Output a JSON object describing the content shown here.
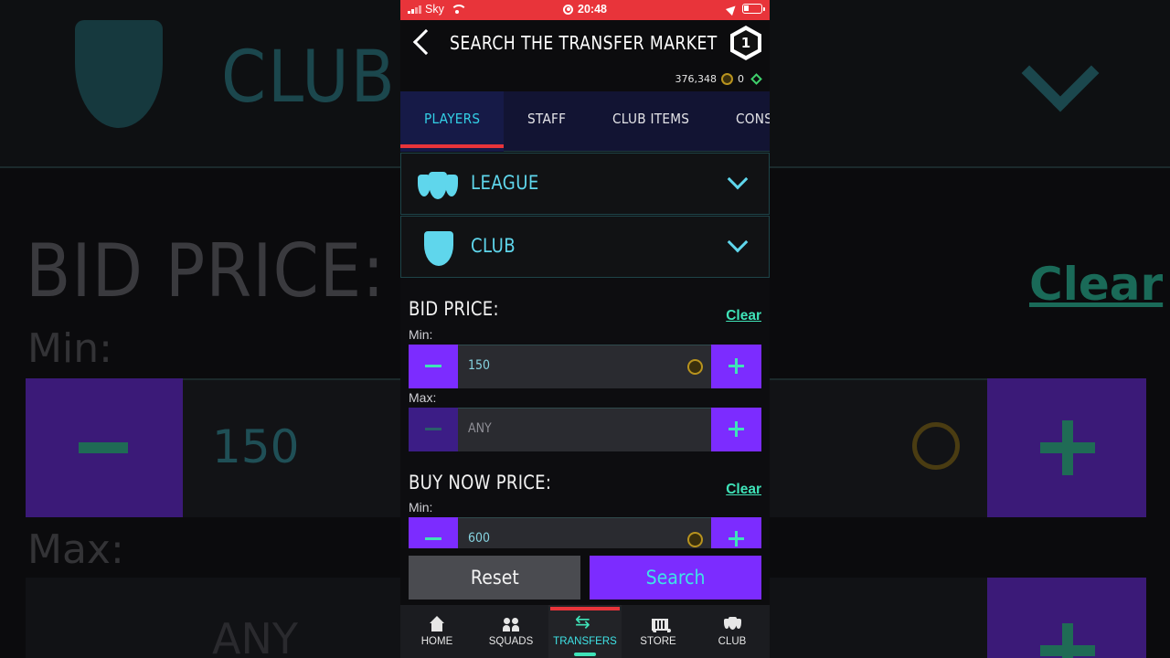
{
  "backdrop": {
    "club_label": "CLUB",
    "bid_price_label": "BID PRICE:",
    "clear_label": "Clear",
    "min_label": "Min:",
    "min_value": "150",
    "max_label": "Max:",
    "max_value": "ANY"
  },
  "status_bar": {
    "carrier": "Sky",
    "time": "20:48"
  },
  "header": {
    "title": "SEARCH THE TRANSFER MARKET",
    "logo_text": "1"
  },
  "wallet": {
    "coins": "376,348",
    "points": "0"
  },
  "tabs": [
    {
      "label": "PLAYERS",
      "active": true
    },
    {
      "label": "STAFF",
      "active": false
    },
    {
      "label": "CLUB ITEMS",
      "active": false
    },
    {
      "label": "CONS",
      "active": false
    }
  ],
  "filters": {
    "league": "LEAGUE",
    "club": "CLUB"
  },
  "bid_price": {
    "title": "BID PRICE:",
    "clear": "Clear",
    "min_label": "Min:",
    "min_value": "150",
    "max_label": "Max:",
    "max_placeholder": "ANY"
  },
  "buy_now_price": {
    "title": "BUY NOW PRICE:",
    "clear": "Clear",
    "min_label": "Min:",
    "min_value": "600"
  },
  "actions": {
    "reset": "Reset",
    "search": "Search"
  },
  "bottom_nav": [
    {
      "label": "HOME",
      "icon": "home-icon",
      "active": false
    },
    {
      "label": "SQUADS",
      "icon": "squads-icon",
      "active": false
    },
    {
      "label": "TRANSFERS",
      "icon": "transfers-icon",
      "active": true
    },
    {
      "label": "STORE",
      "icon": "store-icon",
      "active": false
    },
    {
      "label": "CLUB",
      "icon": "club-icon",
      "active": false
    }
  ],
  "colors": {
    "accent_purple": "#7c2cff",
    "accent_cyan": "#5fd6ec",
    "accent_green": "#3fe3b8",
    "status_red": "#e8343a"
  }
}
